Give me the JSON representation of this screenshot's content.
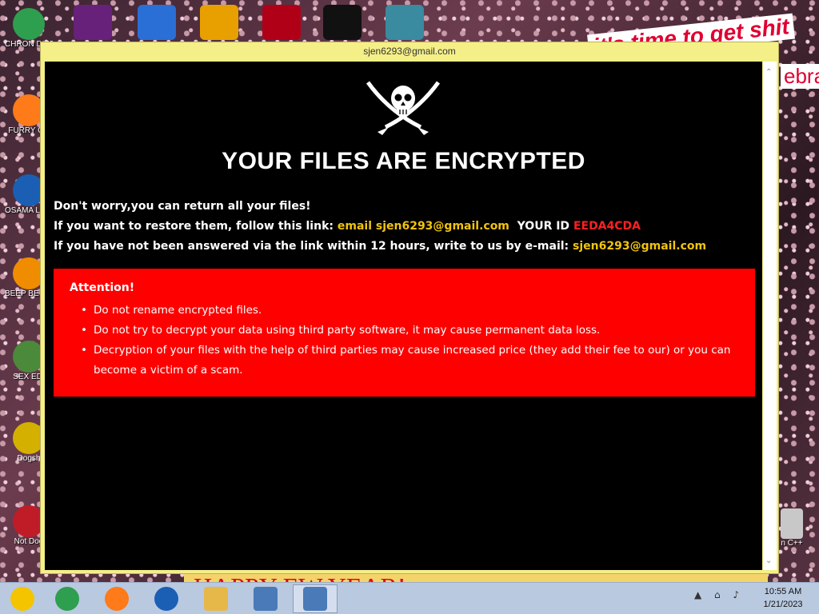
{
  "window": {
    "title": "sjen6293@gmail.com"
  },
  "note": {
    "headline": "YOUR FILES ARE ENCRYPTED",
    "line1": "Don't worry,you can return all your files!",
    "line2_prefix": "If you want to restore them, follow this link:",
    "line2_link": "email sjen6293@gmail.com",
    "line2_id_label": "YOUR ID",
    "line2_id_value": "EEDA4CDA",
    "line3_prefix": "If you have not been answered via the link within 12 hours, write to us by e-mail:",
    "line3_email": "sjen6293@gmail.com",
    "attention": {
      "title": "Attention!",
      "items": [
        "Do not rename encrypted files.",
        "Do not try to decrypt your data using third party software, it may cause permanent data loss.",
        "Decryption of your files with the help of third parties may cause increased price (they add their fee to our) or you can become a victim of a scam."
      ]
    }
  },
  "desktop": {
    "icons": [
      {
        "label": "CHRON DISEA",
        "icon": "chrome-icon",
        "color": "#2e9e4f"
      },
      {
        "label": "FURRY CU",
        "icon": "firefox-icon",
        "color": "#ff7a18"
      },
      {
        "label": "OSAMA LADEN B",
        "icon": "obama-logo-icon",
        "color": "#1a5fb4"
      },
      {
        "label": "BEEP BE CAR",
        "icon": "vlc-cone-icon",
        "color": "#f08c00"
      },
      {
        "label": "SEX EDI",
        "icon": "hxd-icon",
        "color": "#4a8a3a"
      },
      {
        "label": "Dogsh",
        "icon": "cd-disc-icon",
        "color": "#d4b000"
      },
      {
        "label": "Not Dog",
        "icon": "devcpp-icon",
        "color": "#c01c28"
      }
    ],
    "right_icon_label": "n C++",
    "top_icons": [
      {
        "icon": "visual-studio-icon",
        "color": "#68217a"
      },
      {
        "icon": "photoscape-icon",
        "color": "#2a6fd6"
      },
      {
        "icon": "p-logo-icon",
        "color": "#e8a000"
      },
      {
        "icon": "bird-logo-icon",
        "color": "#b00018"
      },
      {
        "icon": "cmd-icon",
        "color": "#111111"
      },
      {
        "icon": "game-icon",
        "color": "#3a8aa0"
      }
    ],
    "wallpaper_text_top": "it's time to get shit",
    "wallpaper_text_side": "ebra",
    "wallpaper_text_bottom": "HAPPY   EW YEAR!"
  },
  "taskbar": {
    "items": [
      {
        "icon": "chrome-colored-icon",
        "color": "#f4c400",
        "active": false
      },
      {
        "icon": "chrome-icon",
        "color": "#2e9e4f",
        "active": false
      },
      {
        "icon": "firefox-icon",
        "color": "#ff7a18",
        "active": false
      },
      {
        "icon": "obama-logo-icon",
        "color": "#1a5fb4",
        "active": false
      },
      {
        "icon": "folder-icon",
        "color": "#e6b84a",
        "active": false
      },
      {
        "icon": "network-computer-icon",
        "color": "#4a7ab8",
        "active": false
      },
      {
        "icon": "network-computer-icon",
        "color": "#4a7ab8",
        "active": true
      }
    ],
    "tray_icons": "▲ ⌂ ♪",
    "time": "10:55 AM",
    "date": "1/21/2023"
  }
}
